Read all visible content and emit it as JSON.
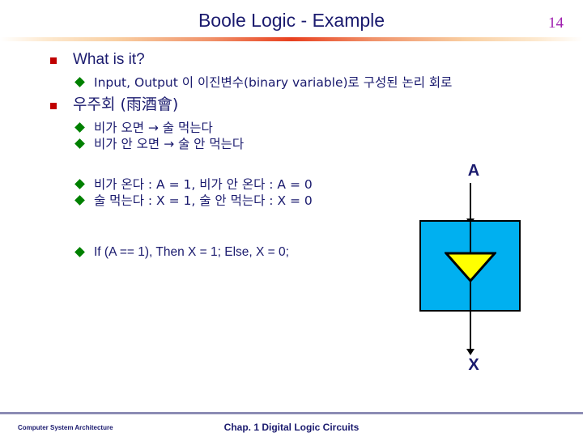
{
  "header": {
    "title": "Boole Logic - Example",
    "page_number": "14",
    "rule_color_center": "#e8401f",
    "rule_color_edge": "#fde9cf",
    "page_number_color": "#a020b0",
    "title_color": "#1a1a6e"
  },
  "content": {
    "bullet1": {
      "text": "What is it?",
      "marker": "red-square-bullet",
      "marker_color": "#c00000",
      "sub": [
        {
          "text": "Input, Output 이 이진변수(binary variable)로 구성된 논리 회로",
          "marker": "green-diamond-bullet",
          "marker_color": "#008000"
        }
      ]
    },
    "bullet2": {
      "text": "우주회 (雨酒會)",
      "marker": "red-square-bullet",
      "marker_color": "#c00000",
      "sub": [
        {
          "text": "비가 오면 → 술 먹는다",
          "marker": "green-diamond-bullet"
        },
        {
          "text": "비가 안 오면 → 술 안 먹는다",
          "marker": "green-diamond-bullet"
        }
      ]
    },
    "group3": [
      {
        "text": "비가 온다 : A = 1, 비가 안 온다 : A = 0",
        "marker": "green-diamond-bullet"
      },
      {
        "text": "술 먹는다 : X = 1, 술 안 먹는다 : X = 0",
        "marker": "green-diamond-bullet"
      }
    ],
    "group4": [
      {
        "text": "If (A == 1), Then X = 1;  Else, X = 0;",
        "marker": "green-diamond-bullet"
      }
    ]
  },
  "diagram": {
    "input_label": "A",
    "output_label": "X",
    "box_color": "#00b0f0",
    "box_border_color": "#000000",
    "gate_color": "#ffff00",
    "gate_shape": "down-triangle",
    "input_wire": "arrow-down-into-box",
    "output_wire": "arrow-down-from-box"
  },
  "footer": {
    "left": "Computer System Architecture",
    "center": "Chap. 1 Digital Logic Circuits",
    "rule_color": "#8c8cb4"
  }
}
